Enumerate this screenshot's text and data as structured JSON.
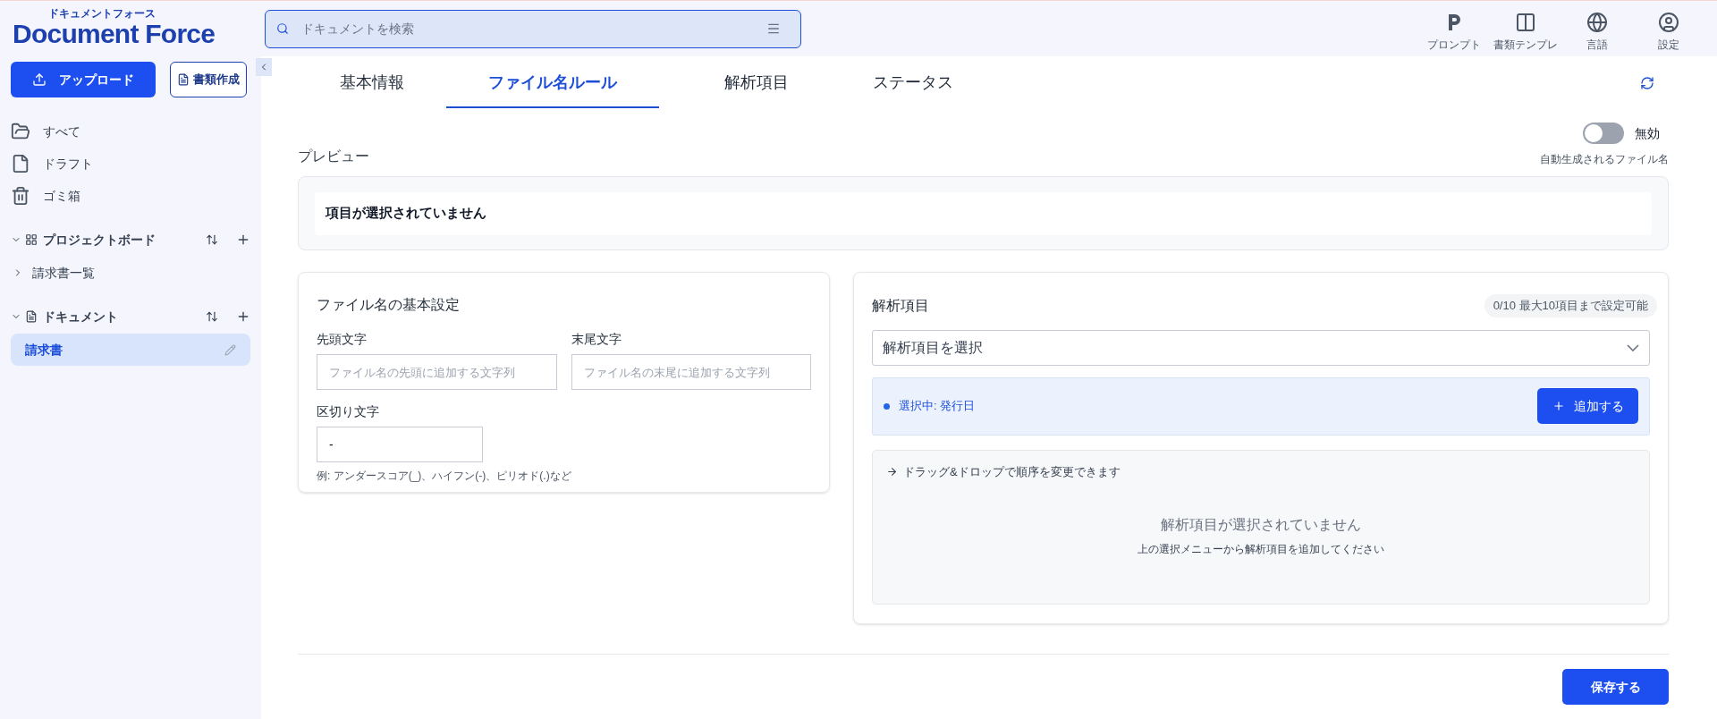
{
  "logo": {
    "subtitle": "ドキュメントフォース",
    "title": "Document Force"
  },
  "sidebar": {
    "upload_button": "アップロード",
    "create_button": "書類作成",
    "nav": [
      {
        "kind": "folder",
        "label": "すべて"
      },
      {
        "kind": "file",
        "label": "ドラフト"
      },
      {
        "kind": "trash",
        "label": "ゴミ箱"
      }
    ],
    "sections": [
      {
        "kind": "board",
        "title": "プロジェクトボード",
        "expanded": true,
        "items": [
          {
            "label": "請求書一覧",
            "selected": false
          }
        ]
      },
      {
        "kind": "document",
        "title": "ドキュメント",
        "expanded": true,
        "items": [
          {
            "label": "請求書",
            "selected": true
          }
        ]
      }
    ]
  },
  "search": {
    "placeholder": "ドキュメントを検索"
  },
  "toolbar": [
    {
      "kind": "p",
      "label": "プロンプト"
    },
    {
      "kind": "template",
      "label": "書類テンプレ"
    },
    {
      "kind": "globe",
      "label": "言語"
    },
    {
      "kind": "user",
      "label": "設定"
    }
  ],
  "tabs": [
    {
      "label": "基本情報",
      "selected": false
    },
    {
      "label": "ファイル名ルール",
      "selected": true
    },
    {
      "label": "解析項目",
      "selected": false
    },
    {
      "label": "ステータス",
      "selected": false
    }
  ],
  "auto_name": {
    "on": false,
    "state_label": "無効",
    "caption": "自動生成されるファイル名"
  },
  "preview": {
    "label": "プレビュー",
    "value": "項目が選択されていません"
  },
  "basic": {
    "title": "ファイル名の基本設定",
    "prefix": {
      "label": "先頭文字",
      "placeholder": "ファイル名の先頭に追加する文字列"
    },
    "suffix": {
      "label": "末尾文字",
      "placeholder": "ファイル名の末尾に追加する文字列"
    },
    "separator": {
      "label": "区切り文字",
      "value": "-",
      "hint": "例: アンダースコア(_)、ハイフン(-)、ピリオド(.)など"
    }
  },
  "fields": {
    "title": "解析項目",
    "count_badge": "0/10 最大10項目まで設定可能",
    "select_placeholder": "解析項目を選択",
    "selected_text": "選択中: 発行日",
    "add_button": "追加する",
    "drag_hint": "ドラッグ&ドロップで順序を変更できます",
    "empty_title": "解析項目が選択されていません",
    "empty_hint": "上の選択メニューから解析項目を追加してください"
  },
  "save_button": "保存する"
}
